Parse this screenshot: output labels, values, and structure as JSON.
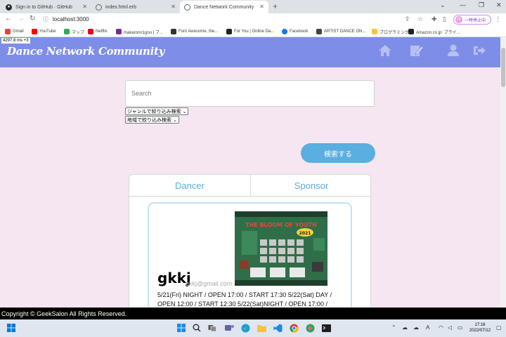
{
  "browser": {
    "tabs": [
      {
        "title": "Sign in to GitHub · GitHub"
      },
      {
        "title": "index.html.erb"
      },
      {
        "title": "Dance Network Community"
      }
    ],
    "new_tab_label": "+",
    "url": "localhost:3000",
    "profile_label": "一時停止中",
    "profile_initial": "HI",
    "bookmarks": [
      {
        "label": "Gmail",
        "color": "#ea4335"
      },
      {
        "label": "YouTube",
        "color": "#ff0000"
      },
      {
        "label": "マップ",
        "color": "#34a853"
      },
      {
        "label": "Netflix",
        "color": "#e50914"
      },
      {
        "label": "makaronn1gou | ブ...",
        "color": "#7b2d8e"
      },
      {
        "label": "Font Awesome, the...",
        "color": "#333333"
      },
      {
        "label": "For You | Online Da...",
        "color": "#222222"
      },
      {
        "label": "Facebook",
        "color": "#1877f2"
      },
      {
        "label": "ARTIST DANCE ON...",
        "color": "#444444"
      },
      {
        "label": "プログラミング",
        "color": "#f4c542"
      },
      {
        "label": "Amazon.co.jp: プライ...",
        "color": "#222222"
      }
    ]
  },
  "perf_overlay": "4297.8 ms +3",
  "site": {
    "logo": "Dance Network Community",
    "nav_icons": [
      "home-icon",
      "edit-icon",
      "user-icon",
      "logout-icon"
    ],
    "header_color": "#7e8ee8"
  },
  "search": {
    "placeholder": "Search",
    "genre_select": "ジャンルで絞り込み検索",
    "area_select": "地域で絞り込み検索",
    "button_label": "検索する"
  },
  "tabs": {
    "dancer": "Dancer",
    "sponsor": "Sponsor"
  },
  "card": {
    "name": "gkkj",
    "email": "gkkj@gmail.com",
    "description": "5/21(Fri) NIGHT / OPEN 17:00 / START 17:30 5/22(Sat) DAY / OPEN 12:00 / START 12:30 5/22(Sat)NIGHT / OPEN 17:00 /",
    "poster_title": "THE BLOOM OF YOUTH",
    "poster_year": "2021"
  },
  "footer": {
    "text": "Copyright © GeekSalon All Rights Reserved."
  },
  "taskbar": {
    "time": "17:16",
    "date": "2022/07/12",
    "ime": "A"
  }
}
